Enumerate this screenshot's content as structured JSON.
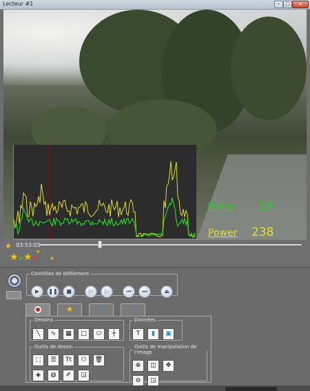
{
  "window": {
    "title": "Lecteur #1",
    "minimize": "─",
    "maximize": "□",
    "close": "✕"
  },
  "overlay": {
    "force_label": "Force",
    "force_value": "19",
    "power_label": "Power",
    "power_value": "238",
    "force_color": "#21d321",
    "power_color": "#e4df24"
  },
  "timeline": {
    "time": "03:53:05",
    "position": 0.23
  },
  "controls": {
    "legend": "Contrôles de défilement",
    "buttons": [
      "play",
      "pause",
      "stop",
      "slow-play",
      "step-forward",
      "previous",
      "next",
      "eject"
    ]
  },
  "tabs": [
    "record",
    "markers",
    "draw",
    "settings"
  ],
  "tools": {
    "dessins_legend": "Dessins",
    "donnees_legend": "Données",
    "outils_legend": "Outils de dessin",
    "manip_legend": "Outils de manipulation de l'image",
    "text_tool": "T",
    "font_tool": "Tt"
  },
  "icons": {
    "star": "star-icon",
    "film": "film-reel-icon"
  }
}
